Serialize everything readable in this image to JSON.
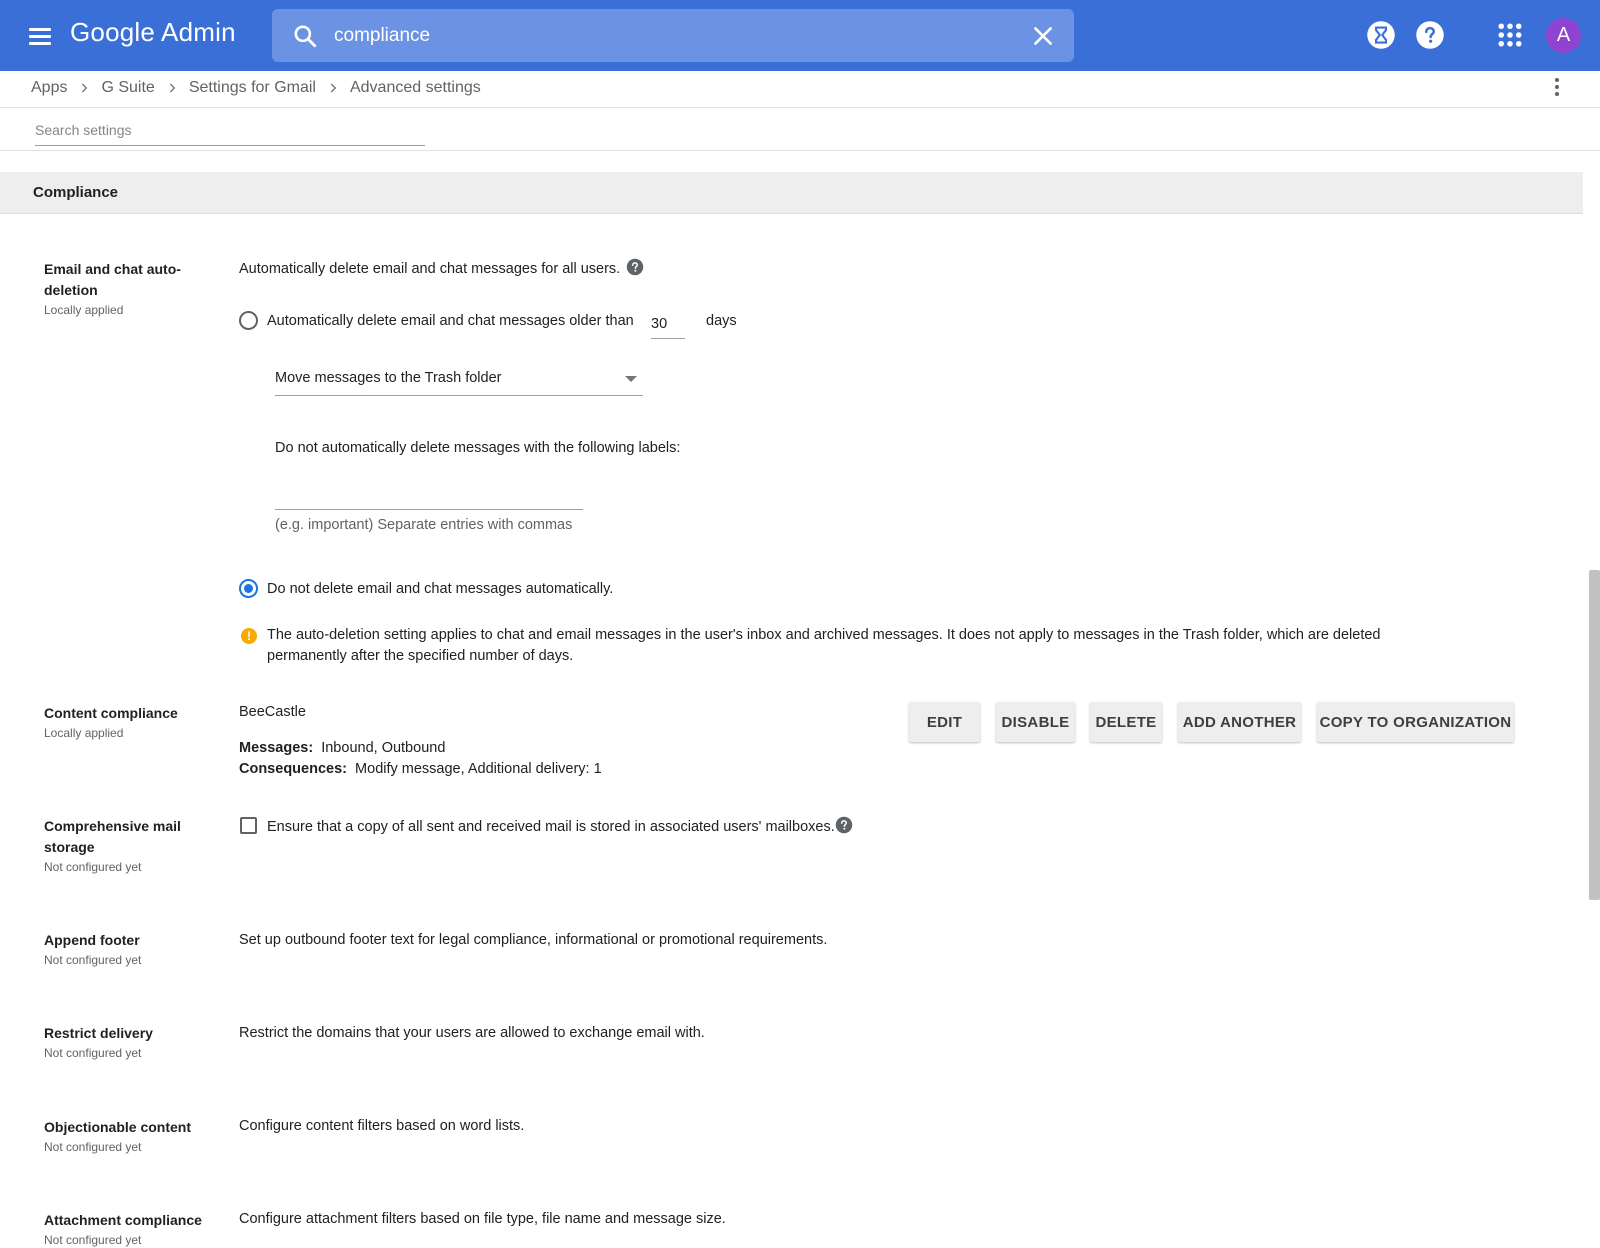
{
  "app": {
    "title": "Google Admin",
    "avatar_letter": "A"
  },
  "search": {
    "value": "compliance",
    "placeholder": "Search"
  },
  "breadcrumb": [
    "Apps",
    "G Suite",
    "Settings for Gmail",
    "Advanced settings"
  ],
  "settings_search": {
    "placeholder": "Search settings"
  },
  "section": {
    "title": "Compliance"
  },
  "auto_deletion": {
    "name": "Email and chat auto-deletion",
    "status": "Locally applied",
    "description": "Automatically delete email and chat messages for all users.",
    "option_older_than": "Automatically delete email and chat messages older than",
    "days_value": "30",
    "days_unit": "days",
    "action_select": "Move messages to the Trash folder",
    "exclude_labels_text": "Do not automatically delete messages with the following labels:",
    "labels_value": "",
    "labels_hint": "(e.g. important) Separate entries with commas",
    "option_do_not_delete": "Do not delete email and chat messages automatically.",
    "selected_option": "do_not_delete",
    "warning": "The auto-deletion setting applies to chat and email messages in the user's inbox and archived messages. It does not apply to messages in the Trash folder, which are deleted permanently after the specified number of days."
  },
  "content_compliance": {
    "name": "Content compliance",
    "status": "Locally applied",
    "rule_name": "BeeCastle",
    "messages_key": "Messages:",
    "messages_value": "Inbound, Outbound",
    "consequences_key": "Consequences:",
    "consequences_value": "Modify message, Additional delivery: 1",
    "buttons": {
      "edit": "EDIT",
      "disable": "DISABLE",
      "delete": "DELETE",
      "add_another": "ADD ANOTHER",
      "copy": "COPY TO ORGANIZATION"
    }
  },
  "comprehensive_storage": {
    "name": "Comprehensive mail storage",
    "status": "Not configured yet",
    "checkbox_label": "Ensure that a copy of all sent and received mail is stored in associated users' mailboxes.",
    "checked": false
  },
  "append_footer": {
    "name": "Append footer",
    "status": "Not configured yet",
    "description": "Set up outbound footer text for legal compliance, informational or promotional requirements."
  },
  "restrict_delivery": {
    "name": "Restrict delivery",
    "status": "Not configured yet",
    "description": "Restrict the domains that your users are allowed to exchange email with."
  },
  "objectionable_content": {
    "name": "Objectionable content",
    "status": "Not configured yet",
    "description": "Configure content filters based on word lists."
  },
  "attachment_compliance": {
    "name": "Attachment compliance",
    "status": "Not configured yet",
    "description": "Configure attachment filters based on file type, file name and message size."
  },
  "colors": {
    "topbar": "#3b6fd8",
    "search_bg": "#6b92e3",
    "accent": "#1a73e8",
    "warning": "#f9ab00",
    "avatar": "#8e44d0"
  },
  "icons": [
    "menu-icon",
    "search-icon",
    "close-icon",
    "hourglass-icon",
    "help-icon",
    "apps-grid-icon",
    "chevron-right-icon",
    "more-vert-icon",
    "warning-icon",
    "dropdown-caret-icon"
  ]
}
